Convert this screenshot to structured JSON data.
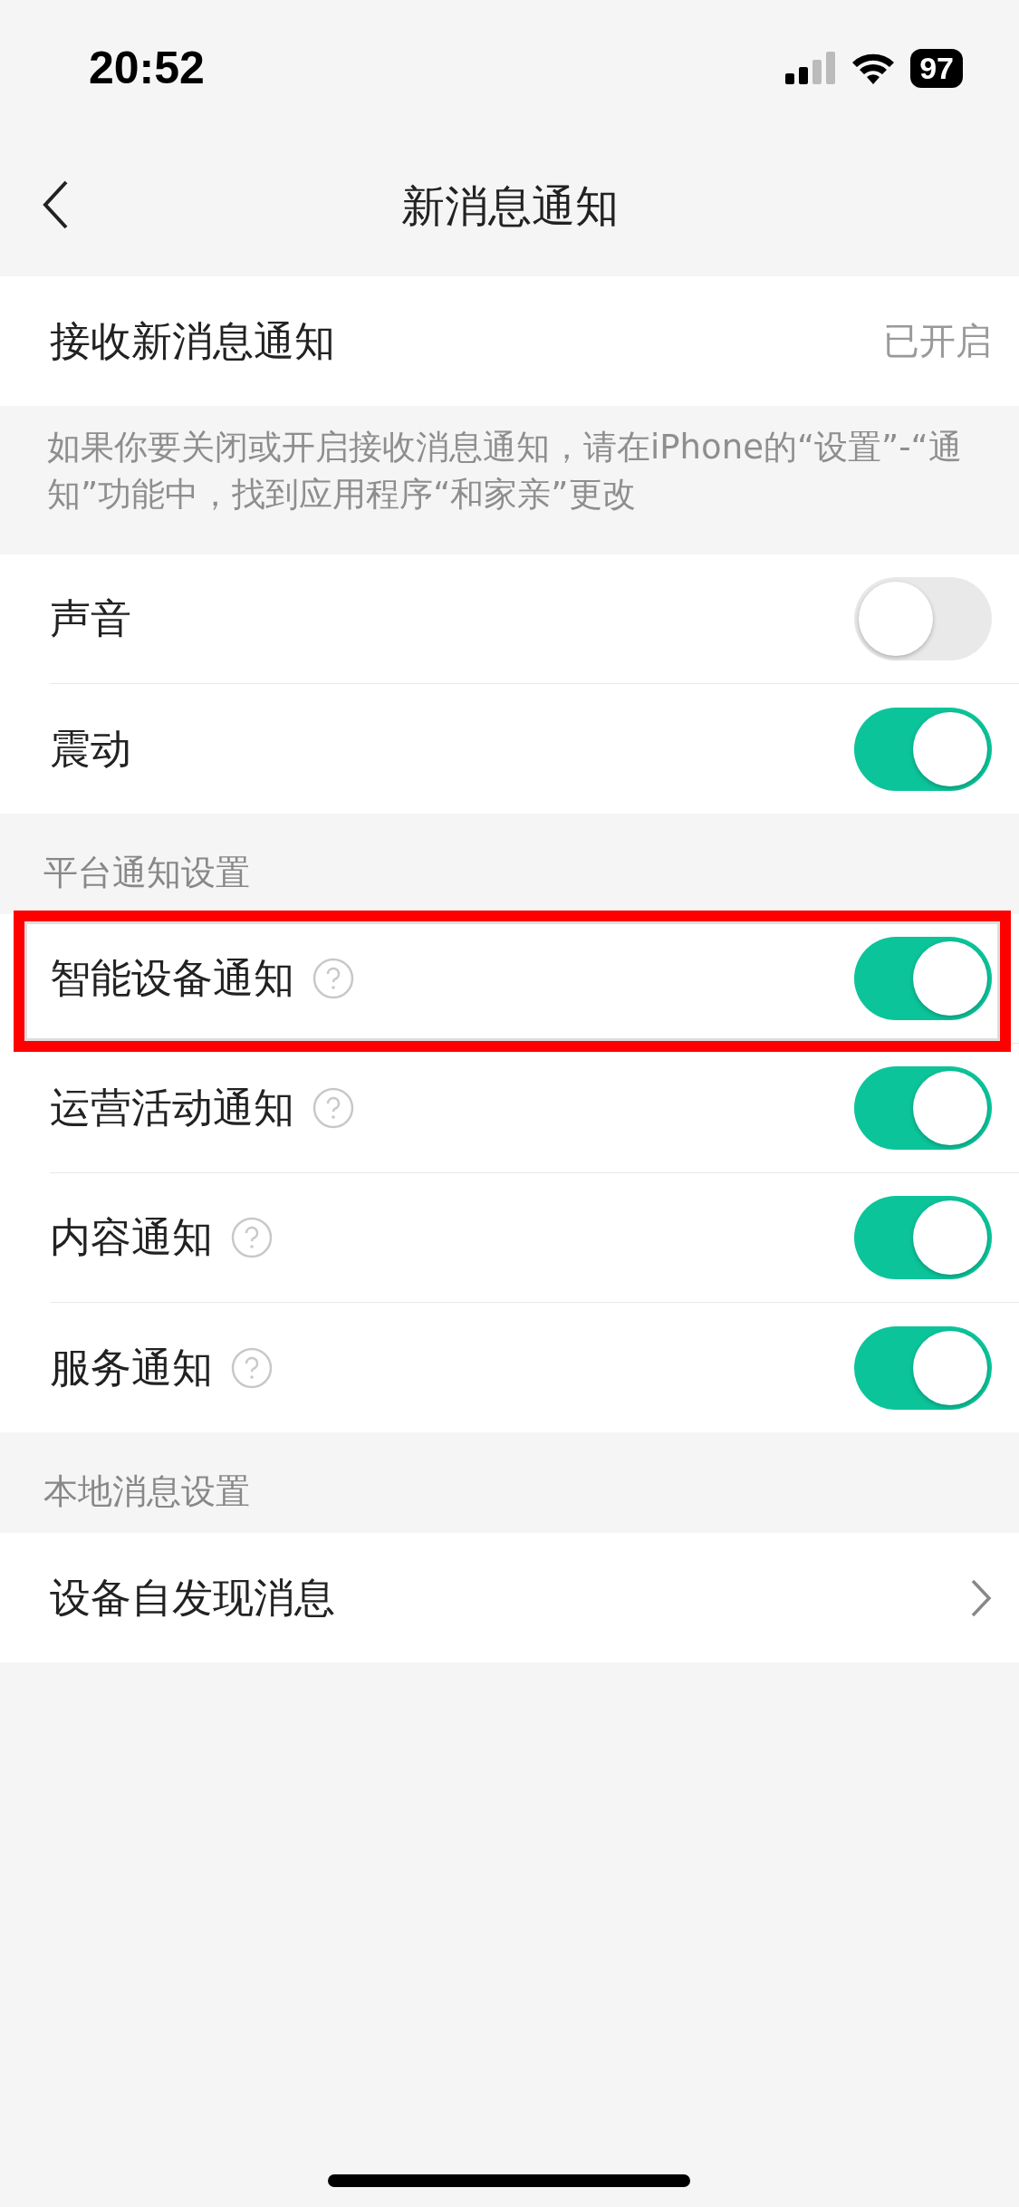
{
  "status_bar": {
    "time": "20:52",
    "battery": "97"
  },
  "nav": {
    "title": "新消息通知"
  },
  "receive": {
    "label": "接收新消息通知",
    "value": "已开启"
  },
  "note": "如果你要关闭或开启接收消息通知，请在iPhone的“设置”-“通知”功能中，找到应用程序“和家亲”更改",
  "basic": [
    {
      "label": "声音",
      "on": false
    },
    {
      "label": "震动",
      "on": true
    }
  ],
  "platform": {
    "header": "平台通知设置",
    "items": [
      {
        "label": "智能设备通知",
        "on": true,
        "highlighted": true
      },
      {
        "label": "运营活动通知",
        "on": true,
        "highlighted": false
      },
      {
        "label": "内容通知",
        "on": true,
        "highlighted": false
      },
      {
        "label": "服务通知",
        "on": true,
        "highlighted": false
      }
    ]
  },
  "local": {
    "header": "本地消息设置",
    "items": [
      {
        "label": "设备自发现消息"
      }
    ]
  }
}
